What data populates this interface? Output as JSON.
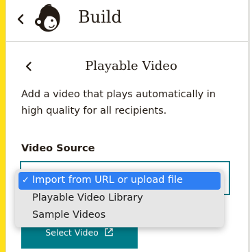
{
  "header": {
    "title": "Build",
    "back_icon": "chevron-left-icon",
    "logo": "mailchimp-logo"
  },
  "panel": {
    "title": "Playable Video",
    "back_icon": "chevron-left-icon",
    "description": "Add a video that plays automatically in high quality for all recipients."
  },
  "video_source": {
    "label": "Video Source",
    "options": [
      {
        "label": "Import from URL or upload file",
        "selected": true
      },
      {
        "label": "Playable Video Library",
        "selected": false
      },
      {
        "label": "Sample Videos",
        "selected": false
      }
    ],
    "check_mark": "✓"
  },
  "select_button": {
    "label": "Select Video",
    "icon": "external-link-icon"
  },
  "colors": {
    "accent": "#ffe01b",
    "primary": "#007c89",
    "highlight": "#2f7ff3",
    "text": "#241c15"
  }
}
